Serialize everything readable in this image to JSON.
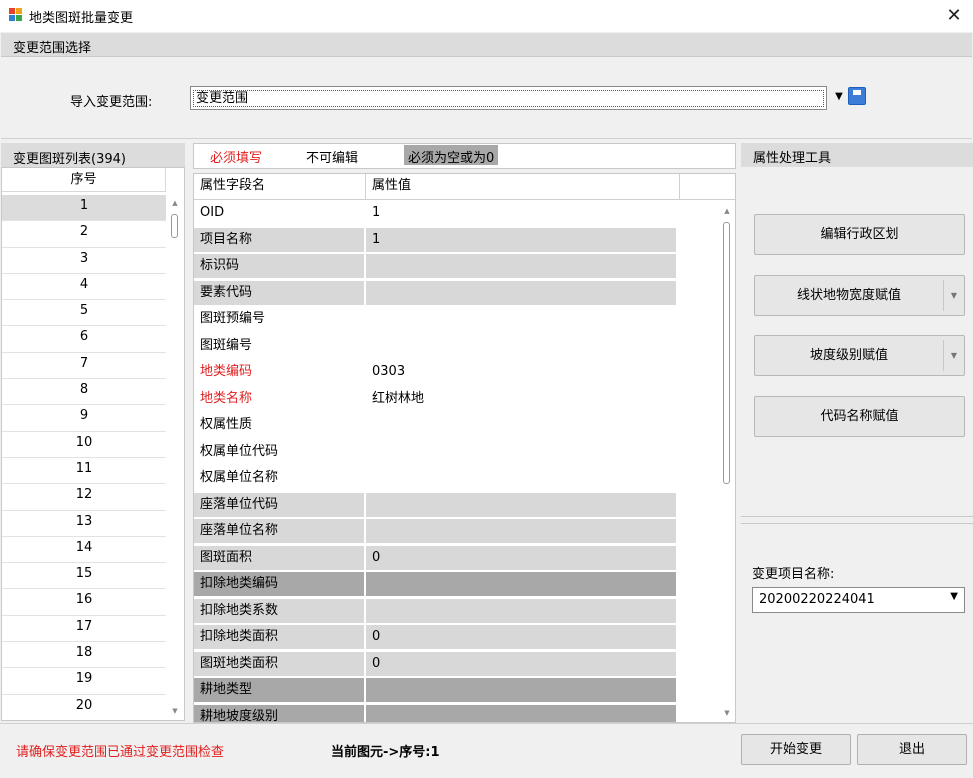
{
  "window": {
    "title": "地类图斑批量变更",
    "close_glyph": "✕"
  },
  "range": {
    "section_title": "变更范围选择",
    "import_label": "导入变更范围:",
    "import_value": "变更范围"
  },
  "list": {
    "header": "变更图斑列表(394)",
    "column": "序号",
    "rows": [
      "1",
      "2",
      "3",
      "4",
      "5",
      "6",
      "7",
      "8",
      "9",
      "10",
      "11",
      "12",
      "13",
      "14",
      "15",
      "16",
      "17",
      "18",
      "19",
      "20"
    ]
  },
  "legend": {
    "required": "必须填写",
    "readonly": "不可编辑",
    "null_or_zero": "必须为空或为0"
  },
  "grid": {
    "col_name": "属性字段名",
    "col_value": "属性值",
    "rows": [
      {
        "name": "OID",
        "value": "1",
        "kind": "normal"
      },
      {
        "name": "项目名称",
        "value": "1",
        "kind": "ro"
      },
      {
        "name": "标识码",
        "value": "",
        "kind": "ro"
      },
      {
        "name": "要素代码",
        "value": "",
        "kind": "ro"
      },
      {
        "name": "图斑预编号",
        "value": "",
        "kind": "normal"
      },
      {
        "name": "图斑编号",
        "value": "",
        "kind": "normal"
      },
      {
        "name": "地类编码",
        "value": "0303",
        "kind": "req"
      },
      {
        "name": "地类名称",
        "value": "红树林地",
        "kind": "req"
      },
      {
        "name": "权属性质",
        "value": "",
        "kind": "normal"
      },
      {
        "name": "权属单位代码",
        "value": "",
        "kind": "normal"
      },
      {
        "name": "权属单位名称",
        "value": "",
        "kind": "normal"
      },
      {
        "name": "座落单位代码",
        "value": "",
        "kind": "ro"
      },
      {
        "name": "座落单位名称",
        "value": "",
        "kind": "ro"
      },
      {
        "name": "图斑面积",
        "value": "0",
        "kind": "ro"
      },
      {
        "name": "扣除地类编码",
        "value": "",
        "kind": "null"
      },
      {
        "name": "扣除地类系数",
        "value": "",
        "kind": "ro"
      },
      {
        "name": "扣除地类面积",
        "value": "0",
        "kind": "ro"
      },
      {
        "name": "图斑地类面积",
        "value": "0",
        "kind": "ro"
      },
      {
        "name": "耕地类型",
        "value": "",
        "kind": "null"
      },
      {
        "name": "耕地坡度级别",
        "value": "",
        "kind": "null"
      }
    ]
  },
  "tools": {
    "header": "属性处理工具",
    "btn_admin": "编辑行政区划",
    "btn_width": "线状地物宽度赋值",
    "btn_slope": "坡度级别赋值",
    "btn_code": "代码名称赋值",
    "project_label": "变更项目名称:",
    "project_value": "20200220224041"
  },
  "footer": {
    "warning": "请确保变更范围已通过变更范围检查",
    "status": "当前图元->序号:1",
    "start": "开始变更",
    "exit": "退出"
  },
  "colors": {
    "required_red": "#e02020",
    "readonly_gray": "#d8d8d8",
    "null_gray": "#a8a8a8"
  }
}
